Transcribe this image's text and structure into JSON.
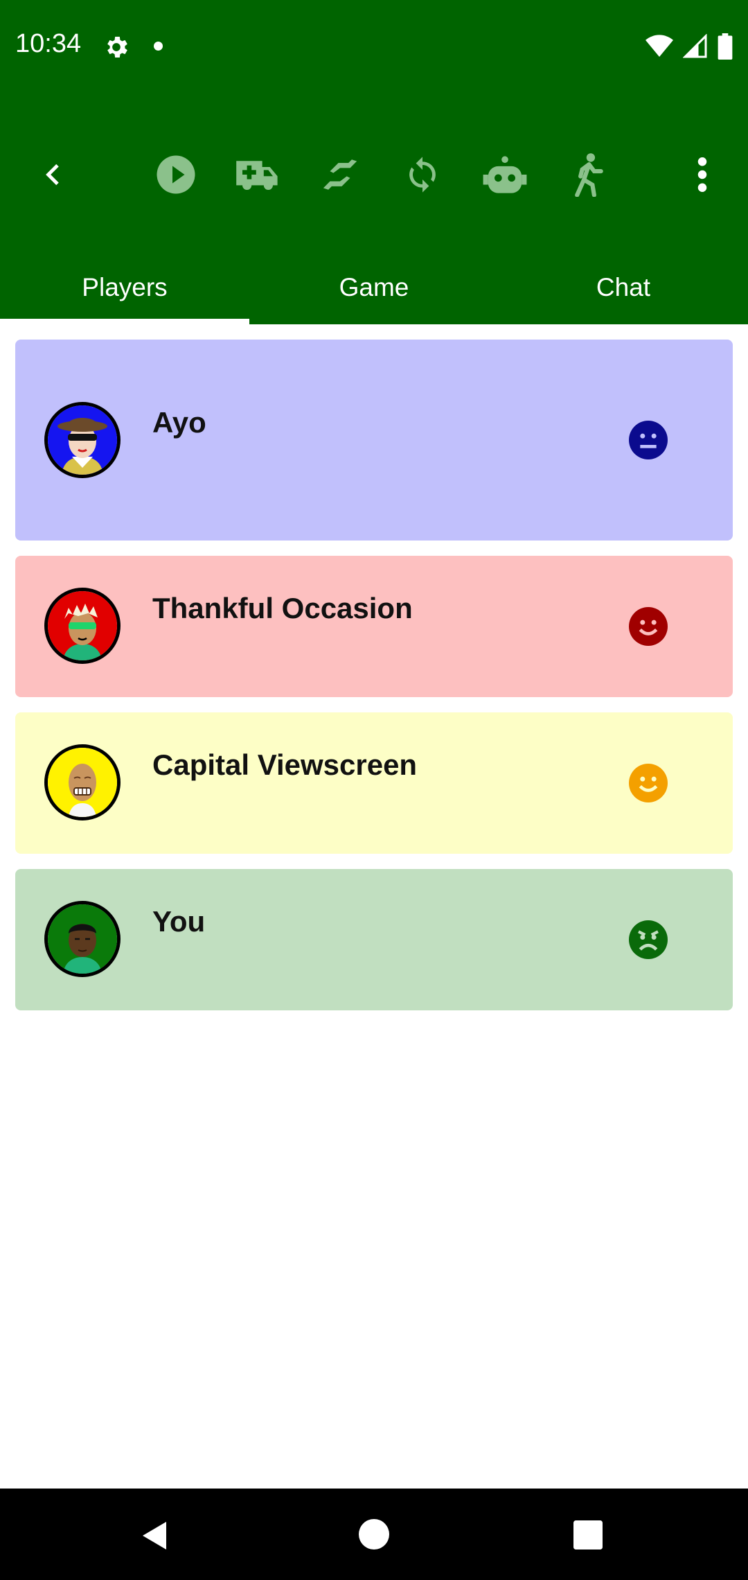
{
  "status": {
    "time": "10:34"
  },
  "tabs": [
    {
      "label": "Players"
    },
    {
      "label": "Game"
    },
    {
      "label": "Chat"
    }
  ],
  "players": [
    {
      "name": "Ayo",
      "card_color": "#C1C0FC",
      "avatar_bg": "#1515F0",
      "mood": "neutral",
      "mood_color": "#0B0B8E"
    },
    {
      "name": "Thankful Occasion",
      "card_color": "#FDC0C0",
      "avatar_bg": "#E10000",
      "mood": "happy",
      "mood_color": "#A00000"
    },
    {
      "name": "Capital Viewscreen",
      "card_color": "#FDFEC6",
      "avatar_bg": "#FFF200",
      "mood": "happy",
      "mood_color": "#F4A000"
    },
    {
      "name": "You",
      "card_color": "#C1DFC0",
      "avatar_bg": "#0A7A0A",
      "mood": "angry",
      "mood_color": "#0A6A0A"
    }
  ],
  "colors": {
    "primary": "#006400",
    "toolbar_icon": "#8BC18B",
    "navbar": "#000000"
  }
}
